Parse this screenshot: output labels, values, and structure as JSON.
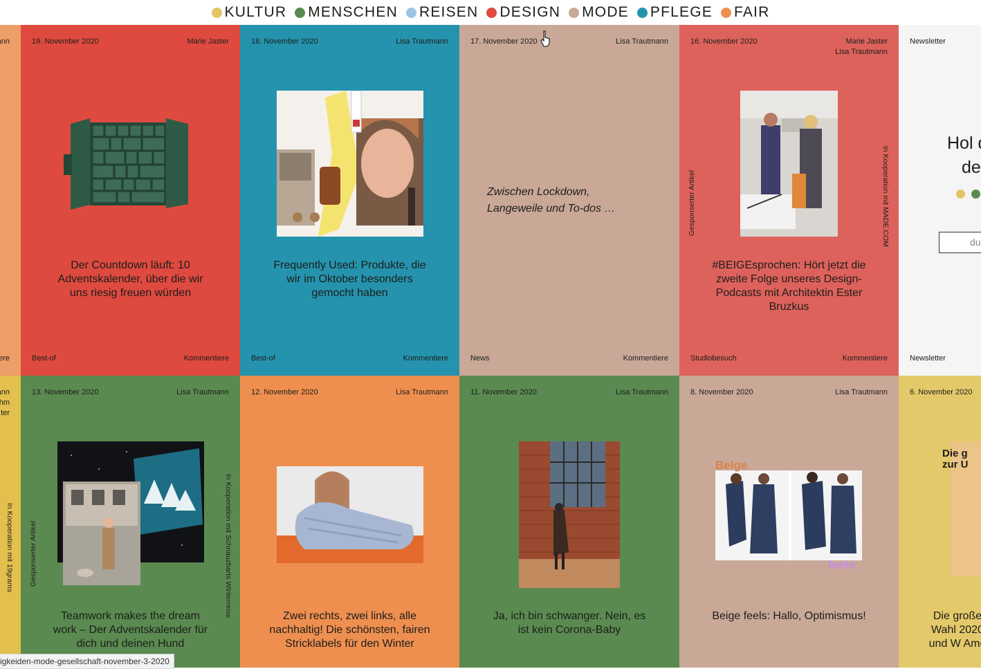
{
  "nav": [
    {
      "label": "KULTUR",
      "color": "#e3c563"
    },
    {
      "label": "MENSCHEN",
      "color": "#5a8a50"
    },
    {
      "label": "REISEN",
      "color": "#9cc6e3"
    },
    {
      "label": "DESIGN",
      "color": "#de4a3f"
    },
    {
      "label": "MODE",
      "color": "#c9a898"
    },
    {
      "label": "PFLEGE",
      "color": "#2593ad"
    },
    {
      "label": "FAIR",
      "color": "#ee8f50"
    }
  ],
  "cards_row1": [
    {
      "date": "19. November 2020",
      "author": "Marie Jaster",
      "title": "Der Countdown läuft: 10 Adventskalender, über die wir uns riesig freuen würden",
      "category": "Best-of",
      "comment": "Kommentiere",
      "color": "#de4a3f",
      "image": "advent-calendar-box"
    },
    {
      "date": "18. November 2020",
      "author": "Lisa Trautmann",
      "title": "Frequently Used: Produkte, die wir im Oktober besonders gemocht haben",
      "category": "Best-of",
      "comment": "Kommentiere",
      "color": "#2593ad",
      "image": "beauty-collage"
    },
    {
      "date": "17. November 2020",
      "author": "Lisa Trautmann",
      "title": "Zwischen Lockdown, Langeweile und To-dos …",
      "category": "News",
      "comment": "Kommentiere",
      "color": "#c9a898"
    },
    {
      "date": "16. November 2020",
      "author": "Marie Jaster",
      "author2": "Lisa Trautmann",
      "title": "#BEIGEsprochen: Hört jetzt die zweite Folge unseres Design-Podcasts mit Architektin Ester Bruzkus",
      "category": "Studiobesuch",
      "comment": "Kommentiere",
      "color": "#dd625b",
      "sponsored": "Gesponserter Artikel",
      "coop": "In Kooperation mit MADE.COM",
      "image": "studio-photo"
    },
    {
      "category": "Newsletter",
      "label": "Newsletter",
      "heading_part1": "Hol d",
      "heading_part2": "de",
      "input_placeholder": "du",
      "color": "#f5f5f5"
    }
  ],
  "cards_row2": [
    {
      "date": "13. November 2020",
      "author": "Lisa Trautmann",
      "title": "Teamwork makes the dream work – Der Adventskalender für dich und deinen Hund",
      "color": "#5a8a50",
      "sponsored": "Gesponserter Artikel",
      "coop": "In Kooperation mit Schnauzbarts Winterreise",
      "image": "dog-collage"
    },
    {
      "date": "12. November 2020",
      "author": "Lisa Trautmann",
      "title": "Zwei rechts, zwei links, alle nachhaltig! Die schönsten, fairen Stricklabels für den Winter",
      "color": "#ee8f50",
      "image": "knit-sweater-photo"
    },
    {
      "date": "11. November 2020",
      "author": "Lisa Trautmann",
      "title": "Ja, ich bin schwanger. Nein, es ist kein Corona-Baby",
      "color": "#5a8a50",
      "image": "pregnant-woman-photo"
    },
    {
      "date": "8. November 2020",
      "author": "Lisa Trautmann",
      "title": "Beige feels: Hallo, Optimismus!",
      "color": "#c9a898",
      "beige_word": "Beige",
      "feels_word": "feels",
      "image": "beige-feels-photo"
    },
    {
      "date": "6. November 2020",
      "title": "Die große Wahl 2020 und W Ame",
      "headline_img": "Die g zur U",
      "color": "#e3c96a"
    }
  ],
  "left_partial": {
    "row1_author": "ann",
    "row1_comment": "iere",
    "row2_lines": [
      "ann",
      "hm",
      "ter"
    ],
    "row2_coop": "In Kooperation mit 19grams",
    "row1_color": "#ee9e68",
    "row2_color": "#e3c04d"
  },
  "status_url": "igkeiden-mode-gesellschaft-november-3-2020"
}
